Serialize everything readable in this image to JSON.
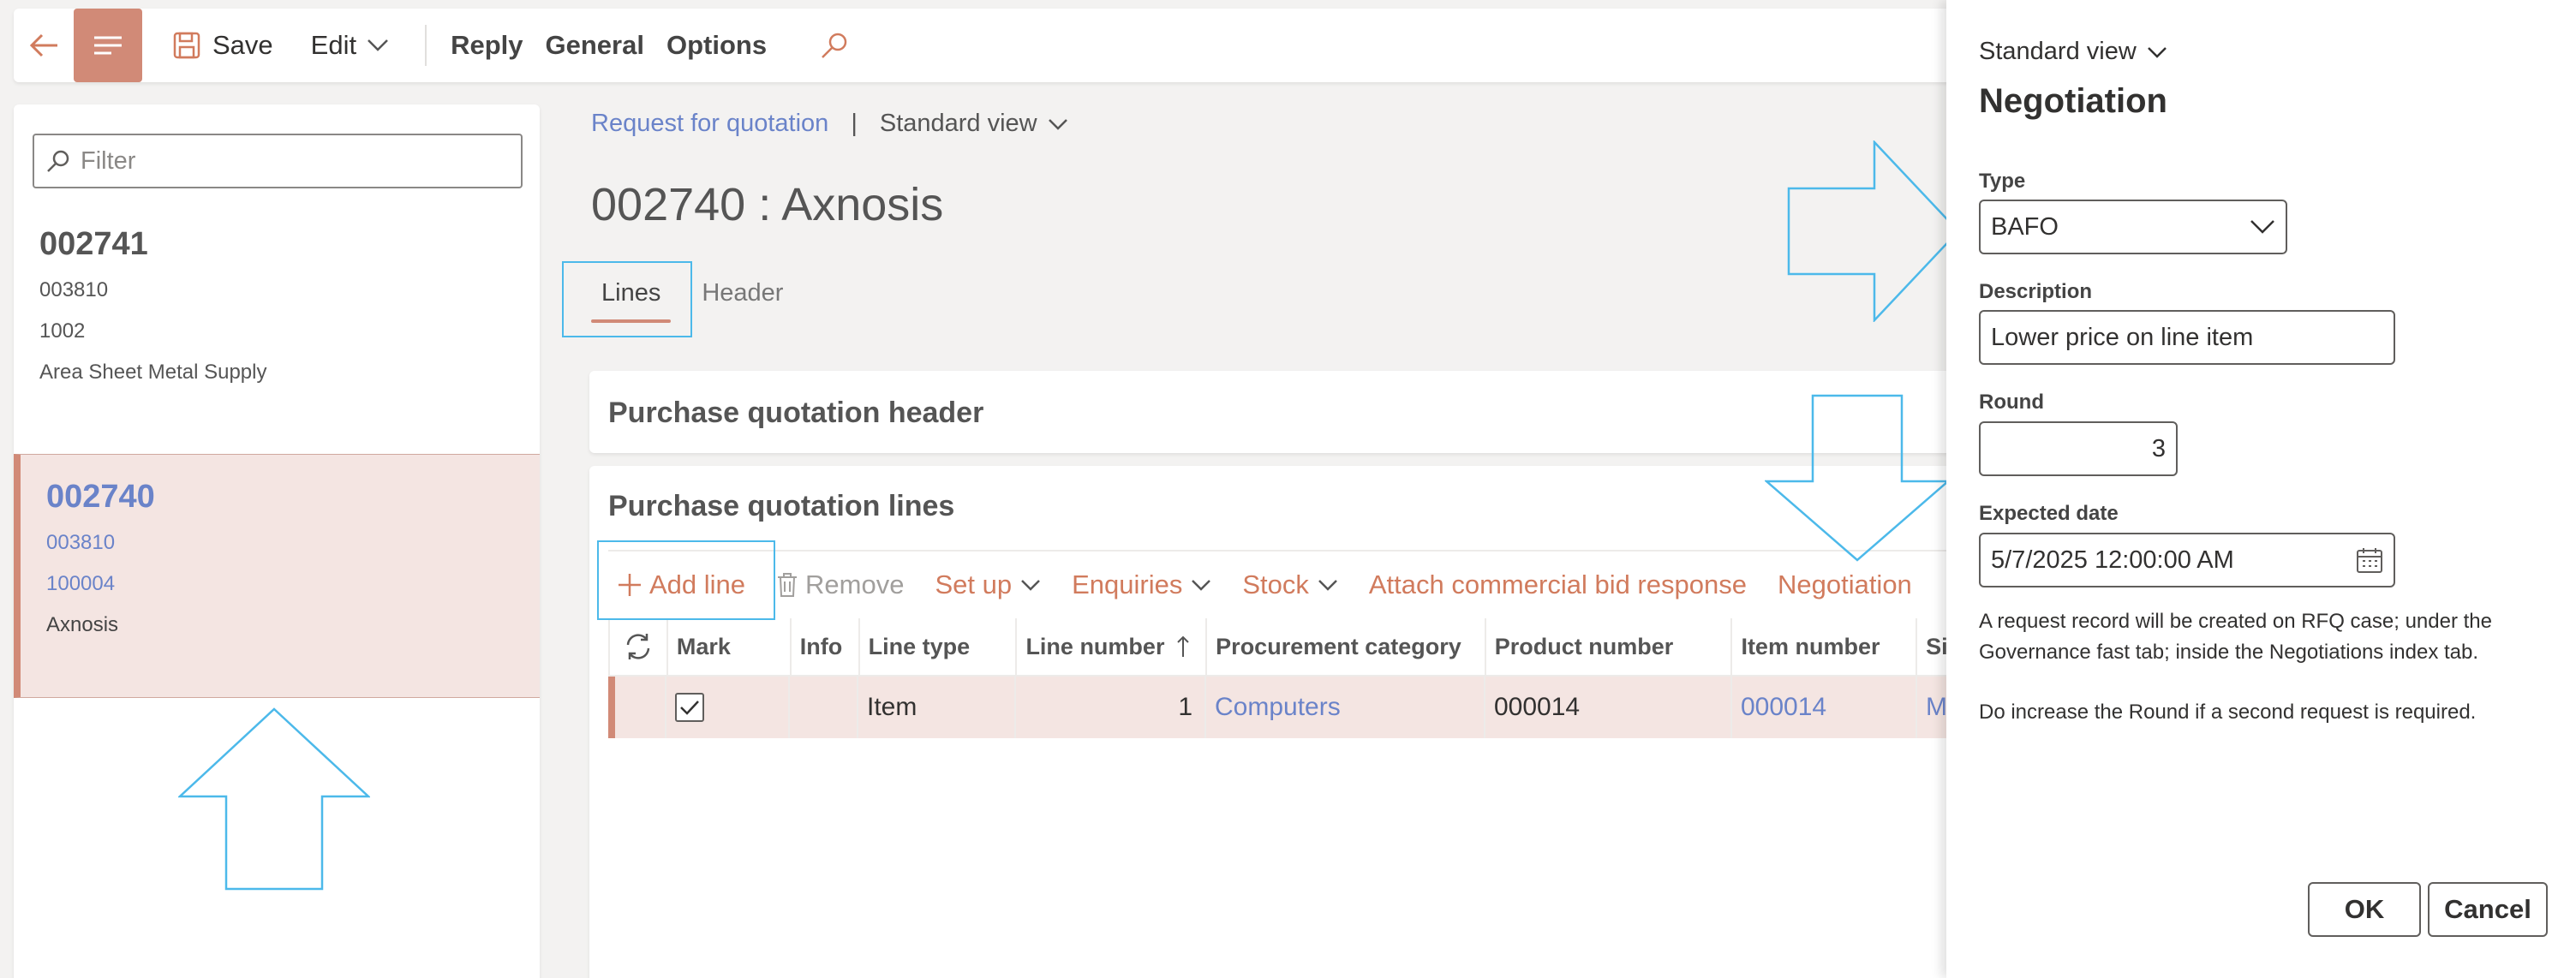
{
  "toolbar": {
    "save_label": "Save",
    "edit_label": "Edit",
    "reply_label": "Reply",
    "general_label": "General",
    "options_label": "Options"
  },
  "list": {
    "filter_placeholder": "Filter",
    "items": [
      {
        "id": "002741",
        "line1": "003810",
        "line2": "1002",
        "line3": "Area Sheet Metal Supply",
        "selected": false
      },
      {
        "id": "002740",
        "line1": "003810",
        "line2": "100004",
        "line3": "Axnosis",
        "selected": true
      }
    ]
  },
  "main": {
    "breadcrumb_link": "Request for quotation",
    "breadcrumb_sep": "|",
    "view_label": "Standard view",
    "title": "002740 : Axnosis",
    "tabs": [
      {
        "label": "Lines"
      },
      {
        "label": "Header"
      }
    ],
    "header_section_title": "Purchase quotation header",
    "lines_section_title": "Purchase quotation lines",
    "actions": {
      "add_line": "Add line",
      "remove": "Remove",
      "set_up": "Set up",
      "enquiries": "Enquiries",
      "stock": "Stock",
      "attach": "Attach commercial bid response",
      "negotiation": "Negotiation"
    },
    "grid": {
      "columns": [
        "Mark",
        "Info",
        "Line type",
        "Line number",
        "Procurement category",
        "Product number",
        "Item number",
        "Si"
      ],
      "rows": [
        {
          "mark": true,
          "info": "",
          "line_type": "Item",
          "line_number": "1",
          "procurement_category": "Computers",
          "product_number": "000014",
          "item_number": "000014",
          "site": "M"
        }
      ]
    }
  },
  "dialog": {
    "view_label": "Standard view",
    "title": "Negotiation",
    "type_label": "Type",
    "type_value": "BAFO",
    "description_label": "Description",
    "description_value": "Lower price on line item",
    "round_label": "Round",
    "round_value": "3",
    "expected_date_label": "Expected date",
    "expected_date_value": "5/7/2025 12:00:00 AM",
    "note1": "A request record will be created on RFQ case; under the Governance fast tab; inside the Negotiations index tab.",
    "note2": "Do increase the Round if a second request is required.",
    "ok_label": "OK",
    "cancel_label": "Cancel"
  },
  "colors": {
    "accent": "#d18a77",
    "link": "#6a83c9",
    "annotation": "#4cb9ea",
    "selected_row": "#f4e5e2"
  }
}
